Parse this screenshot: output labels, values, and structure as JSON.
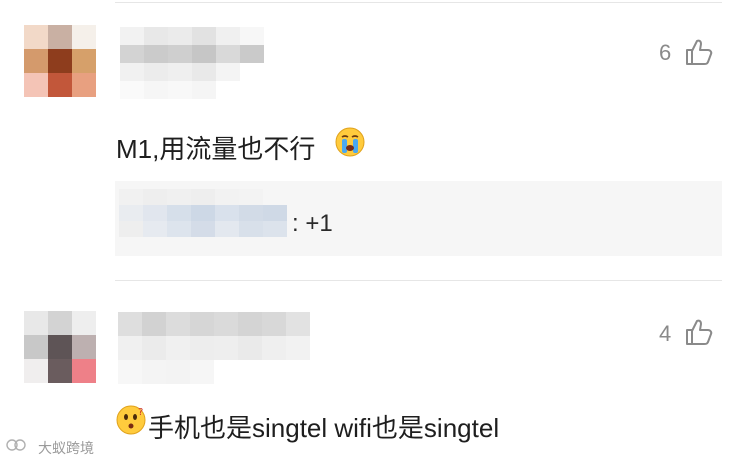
{
  "comments": [
    {
      "text": "M1,用流量也不行",
      "emoji": "crying-face",
      "likes": "6",
      "reply": {
        "text": ": +1"
      }
    },
    {
      "text": "手机也是singtel wifi也是singtel",
      "emoji": "confused-face",
      "likes": "4"
    }
  ],
  "watermark": "大蚁跨境",
  "colors": {
    "divider": "#e6e6e6",
    "reply_bg": "#f6f6f6",
    "like": "#8a8a8a"
  }
}
